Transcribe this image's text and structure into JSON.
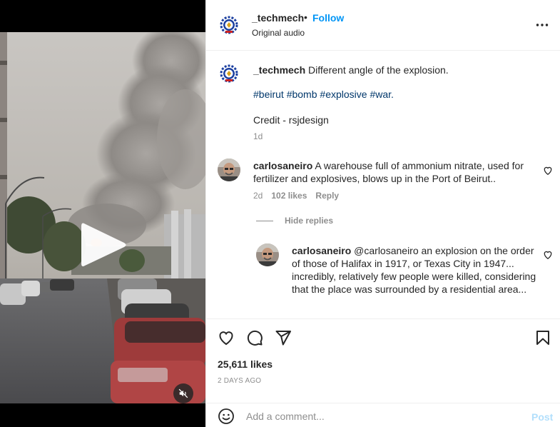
{
  "post": {
    "username": "_techmech",
    "separator": "•",
    "follow_label": "Follow",
    "audio": "Original audio",
    "more_icon": "more-horizontal-icon"
  },
  "caption": {
    "username": "_techmech",
    "text": "Different angle of the explosion.",
    "hashtags": [
      "#beirut",
      "#bomb",
      "#explosive",
      "#war."
    ],
    "credit": "Credit - rsjdesign",
    "time": "1d"
  },
  "comments": [
    {
      "username": "carlosaneiro",
      "text": "A warehouse full of ammonium nitrate, used for fertilizer and explosives, blows up in the Port of Beirut..",
      "time": "2d",
      "likes": "102 likes",
      "reply_label": "Reply",
      "hide_replies_label": "Hide replies"
    },
    {
      "username": "carlosaneiro",
      "text": "@carlosaneiro an explosion on the order of those of Halifax in 1917, or Texas City in 1947... incredibly, relatively few people were killed, considering that the place was surrounded by a residential area..."
    }
  ],
  "actions": {
    "likes": "25,611 likes",
    "date": "2 DAYS AGO"
  },
  "comment_box": {
    "placeholder": "Add a comment...",
    "post_label": "Post"
  },
  "colors": {
    "accent": "#0095f6",
    "hashtag": "#00376b",
    "muted": "#8e8e8e",
    "post_disabled": "#b2dffc"
  }
}
